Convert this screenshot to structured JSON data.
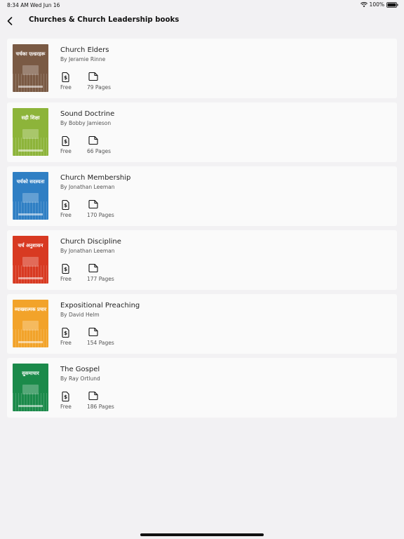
{
  "status_bar": {
    "time": "8:34 AM",
    "date": "Wed Jun 16",
    "battery": "100%"
  },
  "header": {
    "title": "Churches & Church Leadership books",
    "back_icon": "chevron-left-icon"
  },
  "books": [
    {
      "title": "Church Elders",
      "author": "By Jeramie Rinne",
      "price": "Free",
      "pages": "79 Pages",
      "cover_title": "चर्चका एल्डरहरू",
      "cover_color": "#7a5a44"
    },
    {
      "title": "Sound Doctrine",
      "author": "By Bobby Jamieson",
      "price": "Free",
      "pages": "66 Pages",
      "cover_title": "सही शिक्षा",
      "cover_color": "#8db43a"
    },
    {
      "title": "Church Membership",
      "author": "By Jonathan Leeman",
      "price": "Free",
      "pages": "170 Pages",
      "cover_title": "चर्चको सदस्यता",
      "cover_color": "#2f7fc4"
    },
    {
      "title": "Church Discipline",
      "author": "By Jonathan Leeman",
      "price": "Free",
      "pages": "177 Pages",
      "cover_title": "चर्च अनुशासन",
      "cover_color": "#d83a22"
    },
    {
      "title": "Expositional Preaching",
      "author": "By David Helm",
      "price": "Free",
      "pages": "154 Pages",
      "cover_title": "व्याख्यात्मक प्रचार",
      "cover_color": "#f2a32a"
    },
    {
      "title": "The Gospel",
      "author": "By Ray Ortlund",
      "price": "Free",
      "pages": "186 Pages",
      "cover_title": "सुसमाचार",
      "cover_color": "#1b8a4a"
    }
  ],
  "colors": {
    "background": "#f2f1f3",
    "card": "#fafafa",
    "text": "#222222",
    "subtext": "#555555"
  }
}
